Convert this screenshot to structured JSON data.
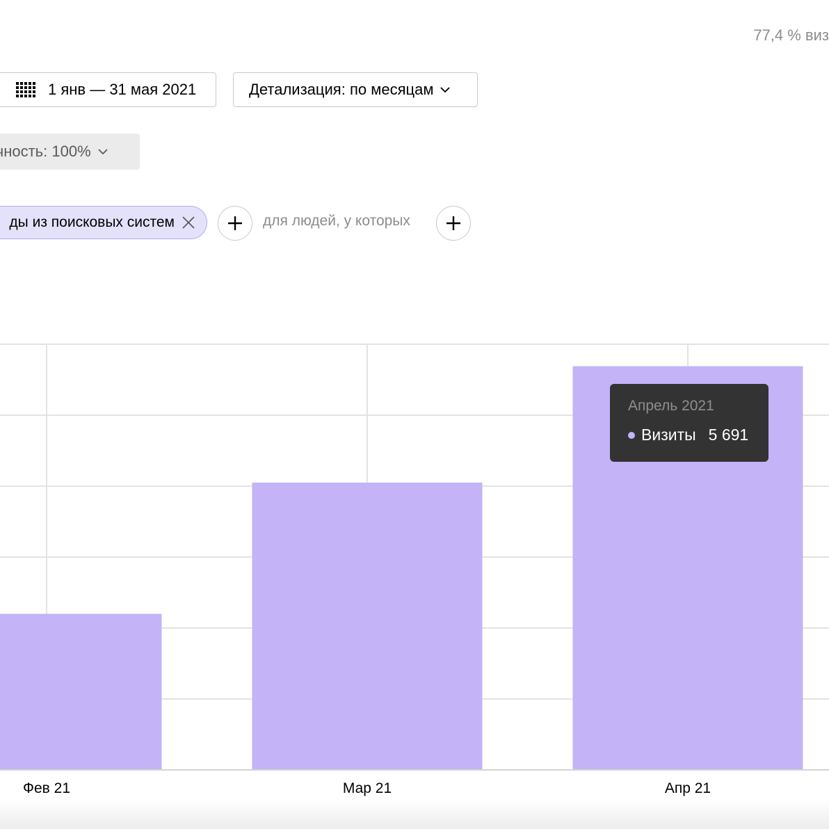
{
  "header": {
    "share_text": "77,4 % виз"
  },
  "toolbar": {
    "date_range_label": "1 янв — 31 мая 2021",
    "detail_label": "Детализация: по месяцам",
    "accuracy_label": "очность: 100%"
  },
  "filters": {
    "segment_chip_label": "ды из поисковых систем",
    "people_label": "для людей, у которых"
  },
  "colors": {
    "bar": "#c4b3f7",
    "tooltip_bg": "#333333",
    "chip_bg": "#e4e1fb"
  },
  "icons": {
    "calendar": "calendar-icon",
    "chevron": "chevron-down-icon",
    "close": "close-icon",
    "plus": "plus-icon"
  },
  "chart_data": {
    "type": "bar",
    "categories": [
      "Фев 21",
      "Мар 21",
      "Апр 21"
    ],
    "series": [
      {
        "name": "Визиты",
        "values": [
          2200,
          4050,
          5691
        ]
      }
    ],
    "xlabel": "",
    "ylabel": "",
    "ylim": [
      0,
      6000
    ],
    "grid": true
  },
  "tooltip": {
    "title": "Апрель 2021",
    "series": "Визиты",
    "value": "5 691"
  }
}
